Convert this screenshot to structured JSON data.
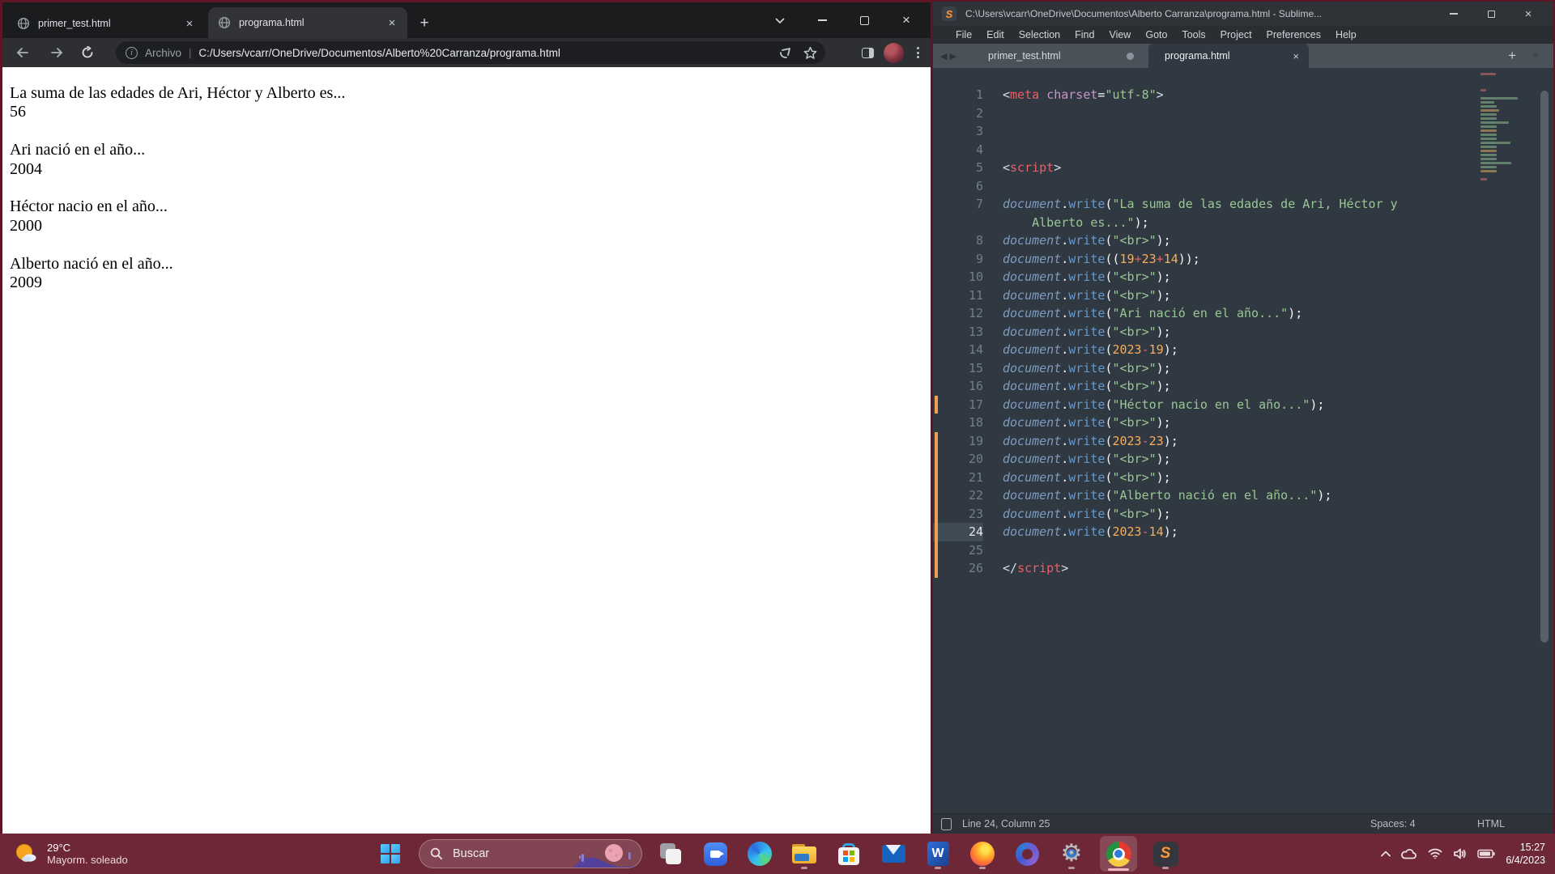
{
  "browser": {
    "tabs": [
      {
        "label": "primer_test.html",
        "active": false
      },
      {
        "label": "programa.html",
        "active": true
      }
    ],
    "toolbar": {
      "scheme_label": "Archivo",
      "url": "C:/Users/vcarr/OneDrive/Documentos/Alberto%20Carranza/programa.html"
    },
    "page_lines": [
      "La suma de las edades de Ari, Héctor y Alberto es...",
      "56",
      "",
      "Ari nació en el año...",
      "2004",
      "",
      "Héctor nacio en el año...",
      "2000",
      "",
      "Alberto nació en el año...",
      "2009"
    ]
  },
  "sublime": {
    "title": "C:\\Users\\vcarr\\OneDrive\\Documentos\\Alberto Carranza\\programa.html - Sublime...",
    "menu": [
      "File",
      "Edit",
      "Selection",
      "Find",
      "View",
      "Goto",
      "Tools",
      "Project",
      "Preferences",
      "Help"
    ],
    "tabs": [
      {
        "label": "primer_test.html",
        "modified": true
      },
      {
        "label": "programa.html",
        "active": true
      }
    ],
    "status": {
      "position": "Line 24, Column 25",
      "indentation": "Spaces: 4",
      "syntax": "HTML"
    },
    "code_lines": [
      {
        "n": 1,
        "t": [
          [
            "ang",
            "<"
          ],
          [
            "tag",
            "meta"
          ],
          [
            "pln",
            " "
          ],
          [
            "attr",
            "charset"
          ],
          [
            "pun",
            "="
          ],
          [
            "str",
            "\"utf-8\""
          ],
          [
            "ang",
            ">"
          ]
        ]
      },
      {
        "n": 2,
        "t": []
      },
      {
        "n": 3,
        "t": []
      },
      {
        "n": 4,
        "t": []
      },
      {
        "n": 5,
        "t": [
          [
            "ang",
            "<"
          ],
          [
            "tag",
            "script"
          ],
          [
            "ang",
            ">"
          ]
        ]
      },
      {
        "n": 6,
        "t": []
      },
      {
        "n": 7,
        "t": [
          [
            "obj",
            "document"
          ],
          [
            "pun",
            "."
          ],
          [
            "fn",
            "write"
          ],
          [
            "pun",
            "("
          ],
          [
            "str",
            "\"La suma de las edades de Ari, Héctor y"
          ],
          [
            "wrap",
            "    "
          ],
          [
            "str",
            "Alberto es...\""
          ],
          [
            "pun",
            ");"
          ]
        ]
      },
      {
        "n": 8,
        "t": [
          [
            "obj",
            "document"
          ],
          [
            "pun",
            "."
          ],
          [
            "fn",
            "write"
          ],
          [
            "pun",
            "("
          ],
          [
            "str",
            "\"<br>\""
          ],
          [
            "pun",
            ");"
          ]
        ]
      },
      {
        "n": 9,
        "t": [
          [
            "obj",
            "document"
          ],
          [
            "pun",
            "."
          ],
          [
            "fn",
            "write"
          ],
          [
            "pun",
            "(("
          ],
          [
            "num",
            "19"
          ],
          [
            "op",
            "+"
          ],
          [
            "num",
            "23"
          ],
          [
            "op",
            "+"
          ],
          [
            "num",
            "14"
          ],
          [
            "pun",
            "));"
          ]
        ]
      },
      {
        "n": 10,
        "t": [
          [
            "obj",
            "document"
          ],
          [
            "pun",
            "."
          ],
          [
            "fn",
            "write"
          ],
          [
            "pun",
            "("
          ],
          [
            "str",
            "\"<br>\""
          ],
          [
            "pun",
            ");"
          ]
        ]
      },
      {
        "n": 11,
        "t": [
          [
            "obj",
            "document"
          ],
          [
            "pun",
            "."
          ],
          [
            "fn",
            "write"
          ],
          [
            "pun",
            "("
          ],
          [
            "str",
            "\"<br>\""
          ],
          [
            "pun",
            ");"
          ]
        ]
      },
      {
        "n": 12,
        "t": [
          [
            "obj",
            "document"
          ],
          [
            "pun",
            "."
          ],
          [
            "fn",
            "write"
          ],
          [
            "pun",
            "("
          ],
          [
            "str",
            "\"Ari nació en el año...\""
          ],
          [
            "pun",
            ");"
          ]
        ]
      },
      {
        "n": 13,
        "t": [
          [
            "obj",
            "document"
          ],
          [
            "pun",
            "."
          ],
          [
            "fn",
            "write"
          ],
          [
            "pun",
            "("
          ],
          [
            "str",
            "\"<br>\""
          ],
          [
            "pun",
            ");"
          ]
        ]
      },
      {
        "n": 14,
        "t": [
          [
            "obj",
            "document"
          ],
          [
            "pun",
            "."
          ],
          [
            "fn",
            "write"
          ],
          [
            "pun",
            "("
          ],
          [
            "num",
            "2023"
          ],
          [
            "op",
            "-"
          ],
          [
            "num",
            "19"
          ],
          [
            "pun",
            ");"
          ]
        ]
      },
      {
        "n": 15,
        "t": [
          [
            "obj",
            "document"
          ],
          [
            "pun",
            "."
          ],
          [
            "fn",
            "write"
          ],
          [
            "pun",
            "("
          ],
          [
            "str",
            "\"<br>\""
          ],
          [
            "pun",
            ");"
          ]
        ]
      },
      {
        "n": 16,
        "t": [
          [
            "obj",
            "document"
          ],
          [
            "pun",
            "."
          ],
          [
            "fn",
            "write"
          ],
          [
            "pun",
            "("
          ],
          [
            "str",
            "\"<br>\""
          ],
          [
            "pun",
            ");"
          ]
        ]
      },
      {
        "n": 17,
        "m": true,
        "t": [
          [
            "obj",
            "document"
          ],
          [
            "pun",
            "."
          ],
          [
            "fn",
            "write"
          ],
          [
            "pun",
            "("
          ],
          [
            "str",
            "\"Héctor nacio en el año...\""
          ],
          [
            "pun",
            ");"
          ]
        ]
      },
      {
        "n": 18,
        "t": [
          [
            "obj",
            "document"
          ],
          [
            "pun",
            "."
          ],
          [
            "fn",
            "write"
          ],
          [
            "pun",
            "("
          ],
          [
            "str",
            "\"<br>\""
          ],
          [
            "pun",
            ");"
          ]
        ]
      },
      {
        "n": 19,
        "m": true,
        "t": [
          [
            "obj",
            "document"
          ],
          [
            "pun",
            "."
          ],
          [
            "fn",
            "write"
          ],
          [
            "pun",
            "("
          ],
          [
            "num",
            "2023"
          ],
          [
            "op",
            "-"
          ],
          [
            "num",
            "23"
          ],
          [
            "pun",
            ");"
          ]
        ]
      },
      {
        "n": 20,
        "m": true,
        "t": [
          [
            "obj",
            "document"
          ],
          [
            "pun",
            "."
          ],
          [
            "fn",
            "write"
          ],
          [
            "pun",
            "("
          ],
          [
            "str",
            "\"<br>\""
          ],
          [
            "pun",
            ");"
          ]
        ]
      },
      {
        "n": 21,
        "m": true,
        "t": [
          [
            "obj",
            "document"
          ],
          [
            "pun",
            "."
          ],
          [
            "fn",
            "write"
          ],
          [
            "pun",
            "("
          ],
          [
            "str",
            "\"<br>\""
          ],
          [
            "pun",
            ");"
          ]
        ]
      },
      {
        "n": 22,
        "m": true,
        "t": [
          [
            "obj",
            "document"
          ],
          [
            "pun",
            "."
          ],
          [
            "fn",
            "write"
          ],
          [
            "pun",
            "("
          ],
          [
            "str",
            "\"Alberto nació en el año...\""
          ],
          [
            "pun",
            ");"
          ]
        ]
      },
      {
        "n": 23,
        "m": true,
        "t": [
          [
            "obj",
            "document"
          ],
          [
            "pun",
            "."
          ],
          [
            "fn",
            "write"
          ],
          [
            "pun",
            "("
          ],
          [
            "str",
            "\"<br>\""
          ],
          [
            "pun",
            ");"
          ]
        ]
      },
      {
        "n": 24,
        "m": true,
        "c": true,
        "t": [
          [
            "obj",
            "document"
          ],
          [
            "pun",
            "."
          ],
          [
            "fn",
            "write"
          ],
          [
            "pun",
            "("
          ],
          [
            "num",
            "2023"
          ],
          [
            "op",
            "-"
          ],
          [
            "num",
            "14"
          ],
          [
            "pun",
            ");"
          ]
        ]
      },
      {
        "n": 25,
        "m": true,
        "t": []
      },
      {
        "n": 26,
        "m": true,
        "t": [
          [
            "ang",
            "</"
          ],
          [
            "tag",
            "script"
          ],
          [
            "ang",
            ">"
          ]
        ]
      }
    ]
  },
  "taskbar": {
    "weather": {
      "temp": "29°C",
      "condition": "Mayorm. soleado"
    },
    "search_label": "Buscar",
    "tray": {
      "time": "15:27",
      "date": "6/4/2023"
    }
  },
  "glyphs": {
    "close": "×",
    "plus": "+",
    "dropdown": "▼",
    "prev": "◀",
    "next": "▶",
    "gear": "⚙",
    "info": "i",
    "word": "W",
    "sublime_s": "S"
  },
  "colors": {
    "window_frame": "#5c1626",
    "taskbar": "#6e2737",
    "editor_bg": "#303841",
    "tabbar_bg": "#4a5159",
    "string_green": "#99c794",
    "number_orange": "#f9ae58",
    "keyword_red": "#ec5f66",
    "modified_marker": "#eda04f"
  }
}
